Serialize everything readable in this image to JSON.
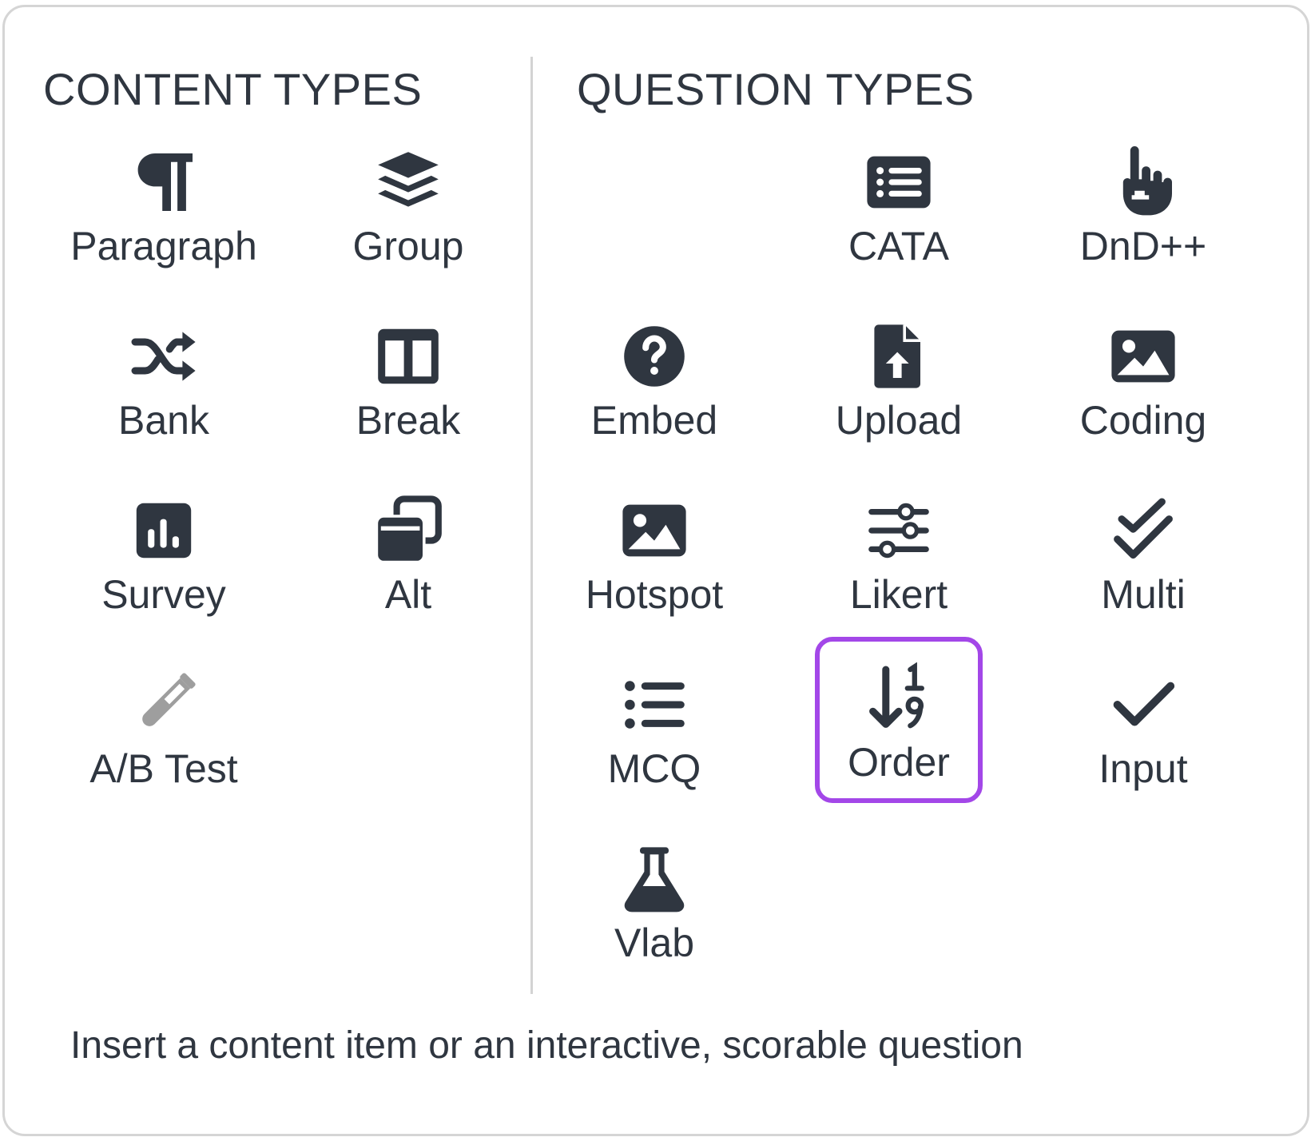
{
  "content_types": {
    "title": "CONTENT TYPES",
    "items": [
      {
        "label": "Paragraph",
        "icon": "paragraph-icon"
      },
      {
        "label": "Group",
        "icon": "layers-icon"
      },
      {
        "label": "Bank",
        "icon": "shuffle-icon"
      },
      {
        "label": "Break",
        "icon": "columns-icon"
      },
      {
        "label": "Survey",
        "icon": "bar-chart-icon"
      },
      {
        "label": "Alt",
        "icon": "clone-icon"
      },
      {
        "label": "A/B Test",
        "icon": "test-tube-icon"
      }
    ]
  },
  "question_types": {
    "title": "QUESTION TYPES",
    "items": [
      {
        "label": "CATA",
        "icon": "list-icon"
      },
      {
        "label": "DnD++",
        "icon": "hand-pointer-icon"
      },
      {
        "label": "Embed",
        "icon": "question-circle-icon"
      },
      {
        "label": "Upload",
        "icon": "file-upload-icon"
      },
      {
        "label": "Coding",
        "icon": "image-icon"
      },
      {
        "label": "Hotspot",
        "icon": "image-icon"
      },
      {
        "label": "Likert",
        "icon": "sliders-icon"
      },
      {
        "label": "Multi",
        "icon": "double-check-icon"
      },
      {
        "label": "MCQ",
        "icon": "bullet-list-icon"
      },
      {
        "label": "Order",
        "icon": "sort-numeric-icon",
        "selected": true
      },
      {
        "label": "Input",
        "icon": "check-icon"
      },
      {
        "label": "Vlab",
        "icon": "flask-icon"
      }
    ]
  },
  "footer": {
    "hint": "Insert a content item or an interactive, scorable question"
  },
  "colors": {
    "icon": "#2f3640",
    "icon_disabled": "#9e9e9e",
    "selection": "#a347e8",
    "divider": "#d3d3d3",
    "panel_border": "#d5d5d5"
  }
}
